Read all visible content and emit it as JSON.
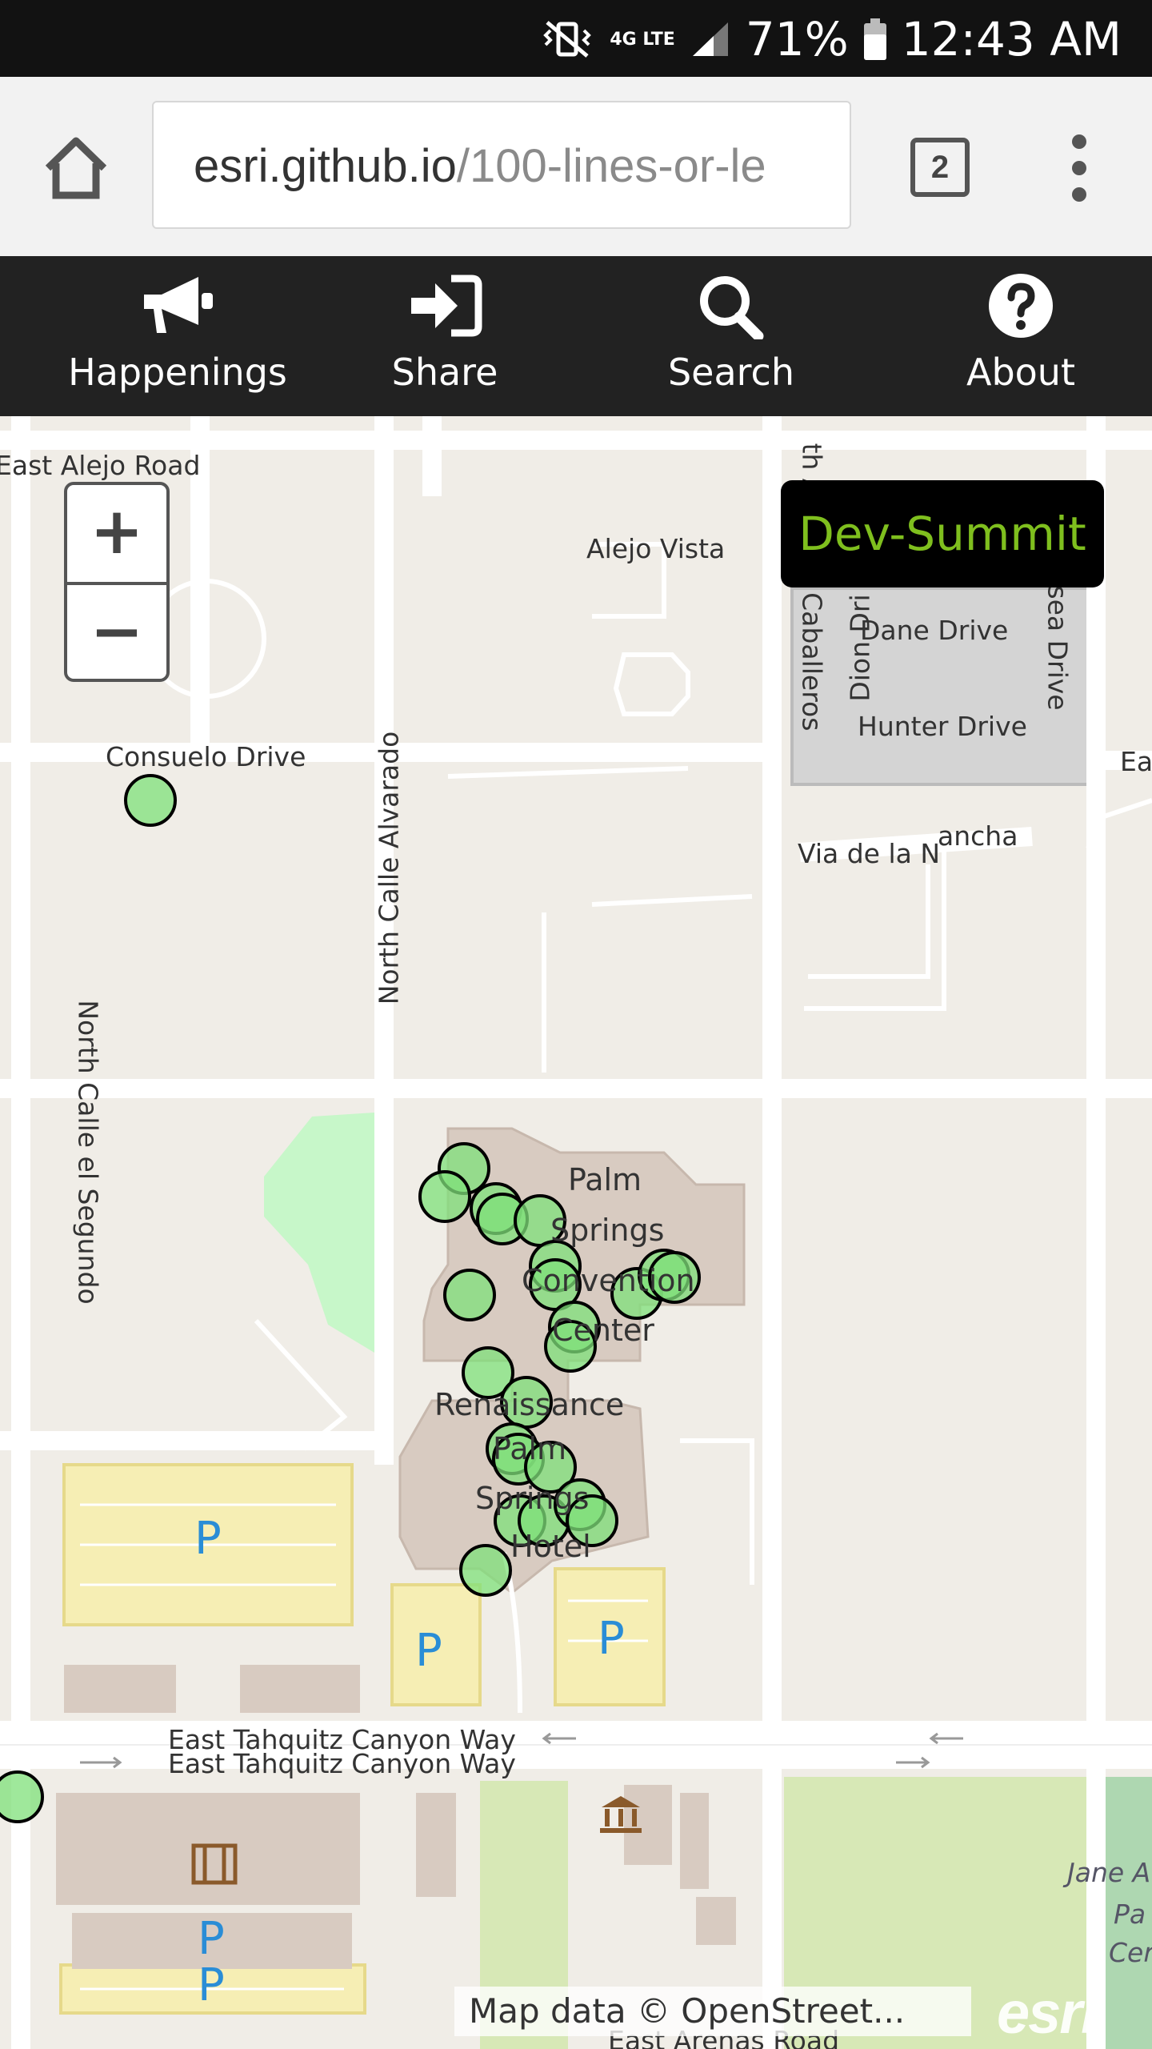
{
  "status_bar": {
    "signal": "4G LTE",
    "battery": "71%",
    "time": "12:43 AM"
  },
  "browser": {
    "url_host": "esri.github.io",
    "url_path": "/100-lines-or-le",
    "tab_count": "2"
  },
  "nav": {
    "items": [
      {
        "label": "Happenings",
        "icon": "megaphone-icon"
      },
      {
        "label": "Share",
        "icon": "sign-in-icon"
      },
      {
        "label": "Search",
        "icon": "search-icon"
      },
      {
        "label": "About",
        "icon": "question-circle-icon"
      }
    ]
  },
  "map": {
    "zoom_in": "+",
    "zoom_out": "−",
    "title_button": "Dev-Summit",
    "attribution": "Map data © OpenStreet...",
    "logo": "esri",
    "parking_label": "P",
    "marker_fill": "#7fe07a",
    "labels": {
      "east_alejo_road": "East Alejo Road",
      "alejo_vista": "Alejo Vista",
      "avenida_caballeros": "th Avenida Caballeros",
      "dane_drive": "Dane Drive",
      "dion_drive": "Dion Dri",
      "hunter_drive": "Hunter Drive",
      "sea_drive": "sea Drive",
      "ea": "Ea",
      "consuelo_drive": "Consuelo Drive",
      "via_de_la": "Via de la N",
      "ancha": "ancha",
      "north_calle_alvarado": "North Calle Alvarado",
      "north_calle_el_segundo": "North Calle el Segundo",
      "palm": "Palm",
      "springs": "Springs",
      "convention": "Convention",
      "center": "Center",
      "renaissance": "Renaissance",
      "palm2": "Palm",
      "springs2": "Springs",
      "hotel": "Hotel",
      "tahquitz_1": "East Tahquitz Canyon Way",
      "tahquitz_2": "East Tahquitz Canyon Way",
      "east_arenas": "East Arenas Road",
      "jane_a": "Jane A",
      "pa": "Pa",
      "cer": "Cer"
    }
  }
}
